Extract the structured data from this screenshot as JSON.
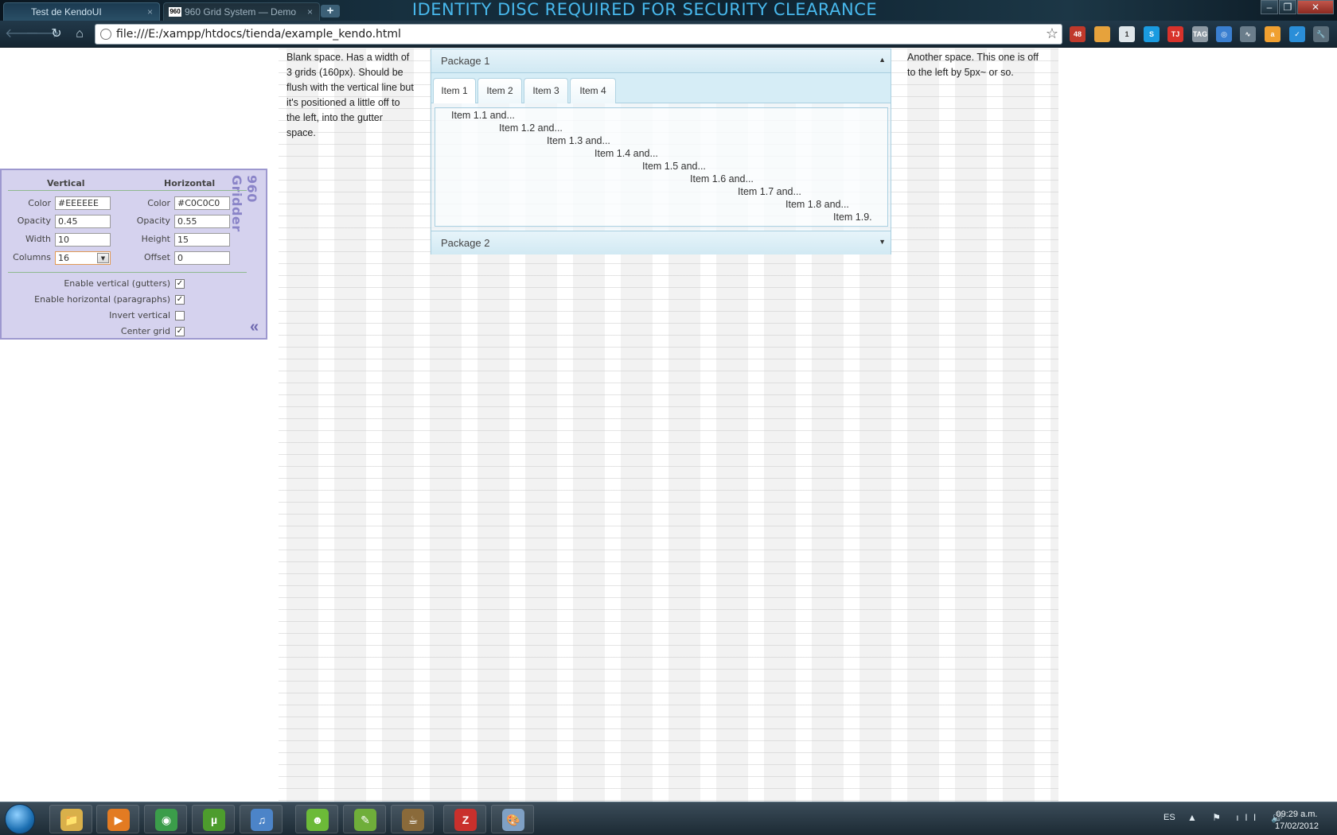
{
  "window": {
    "banner": "IDENTITY DISC REQUIRED FOR SECURITY CLEARANCE",
    "min": "–",
    "max": "❐",
    "close": "✕"
  },
  "tabs": [
    {
      "label": "Test de KendoUI",
      "close": "×"
    },
    {
      "label": "960 Grid System — Demo",
      "close": "×",
      "favicon": "960"
    }
  ],
  "new_tab": "+",
  "toolbar": {
    "back": "🡐",
    "forward": "🡒",
    "reload": "↻",
    "home": "⌂",
    "url": "file:///E:/xampp/htdocs/tienda/example_kendo.html",
    "star": "☆"
  },
  "extensions": [
    {
      "name": "calendar-extension-icon",
      "label": "48",
      "color": "#c0392b"
    },
    {
      "name": "package-extension-icon",
      "label": "",
      "color": "#e6a23c"
    },
    {
      "name": "feed-extension-icon",
      "label": "1",
      "color": "#dfe6ea"
    },
    {
      "name": "skype-extension-icon",
      "label": "S",
      "color": "#1a9be0"
    },
    {
      "name": "tj-extension-icon",
      "label": "TJ",
      "color": "#d8322b"
    },
    {
      "name": "tag-extension-icon",
      "label": "TAG",
      "color": "#8d99a3"
    },
    {
      "name": "circle-extension-icon",
      "label": "◎",
      "color": "#3a7fd0"
    },
    {
      "name": "pulse-extension-icon",
      "label": "∿",
      "color": "#6a7d8b"
    },
    {
      "name": "amazon-extension-icon",
      "label": "a",
      "color": "#f0a030"
    },
    {
      "name": "check-extension-icon",
      "label": "✓",
      "color": "#2a8ed8"
    },
    {
      "name": "wrench-icon",
      "label": "🔧",
      "color": "#5c6f7c"
    }
  ],
  "page": {
    "blank_left": "Blank space. Has a width of 3 grids (160px). Should be flush with the vertical line but it's positioned a little off to the left, into the gutter space.",
    "blank_right": "Another space. This one is off to the left by 5px~ or so.",
    "panelbar": {
      "package1": "Package 1",
      "package1_arrow": "▲",
      "package2": "Package 2",
      "package2_arrow": "▼",
      "tabs": [
        "Item 1",
        "Item 2",
        "Item 3",
        "Item 4"
      ],
      "content_lines": [
        "Item 1.1 and...",
        "Item 1.2 and...",
        "Item 1.3 and...",
        "Item 1.4 and...",
        "Item 1.5 and...",
        "Item 1.6 and...",
        "Item 1.7 and...",
        "Item 1.8 and...",
        "Item 1.9."
      ]
    }
  },
  "gridder": {
    "title": "960 Gridder",
    "vertical": "Vertical",
    "horizontal": "Horizontal",
    "color_label": "Color",
    "opacity_label": "Opacity",
    "width_label": "Width",
    "height_label": "Height",
    "columns_label": "Columns",
    "offset_label": "Offset",
    "v_color": "#EEEEEE",
    "v_opacity": "0.45",
    "v_width": "10",
    "v_columns": "16",
    "h_color": "#C0C0C0",
    "h_opacity": "0.55",
    "h_height": "15",
    "h_offset": "0",
    "opt_vertical": "Enable vertical (gutters)",
    "opt_horizontal": "Enable horizontal (paragraphs)",
    "opt_invert": "Invert vertical",
    "opt_center": "Center grid",
    "check_mark": "✓",
    "dropdown_arrow": "▼",
    "collapse": "«"
  },
  "taskbar": {
    "apps": [
      {
        "name": "explorer-app-icon",
        "color": "#d9b04a",
        "label": "📁"
      },
      {
        "name": "media-player-app-icon",
        "color": "#e37b22",
        "label": "▶"
      },
      {
        "name": "chrome-app-icon",
        "color": "#3b9d4a",
        "label": "◉"
      },
      {
        "name": "utorrent-app-icon",
        "color": "#4d9c2d",
        "label": "µ"
      },
      {
        "name": "itunes-app-icon",
        "color": "#4c84c8",
        "label": "♫"
      },
      {
        "name": "cut-the-rope-app-icon",
        "color": "#6cba38",
        "label": "☻"
      },
      {
        "name": "notepad-app-icon",
        "color": "#6fae3a",
        "label": "✎"
      },
      {
        "name": "java-ide-app-icon",
        "color": "#8a6a3a",
        "label": "☕"
      },
      {
        "name": "filezilla-app-icon",
        "color": "#c9302c",
        "label": "Z"
      },
      {
        "name": "paint-app-icon",
        "color": "#7fa0c4",
        "label": "🎨"
      }
    ],
    "lang": "ES",
    "tray": "▲ ⚑ ıll 🔊",
    "time": "09:29 a.m.",
    "date": "17/02/2012"
  }
}
